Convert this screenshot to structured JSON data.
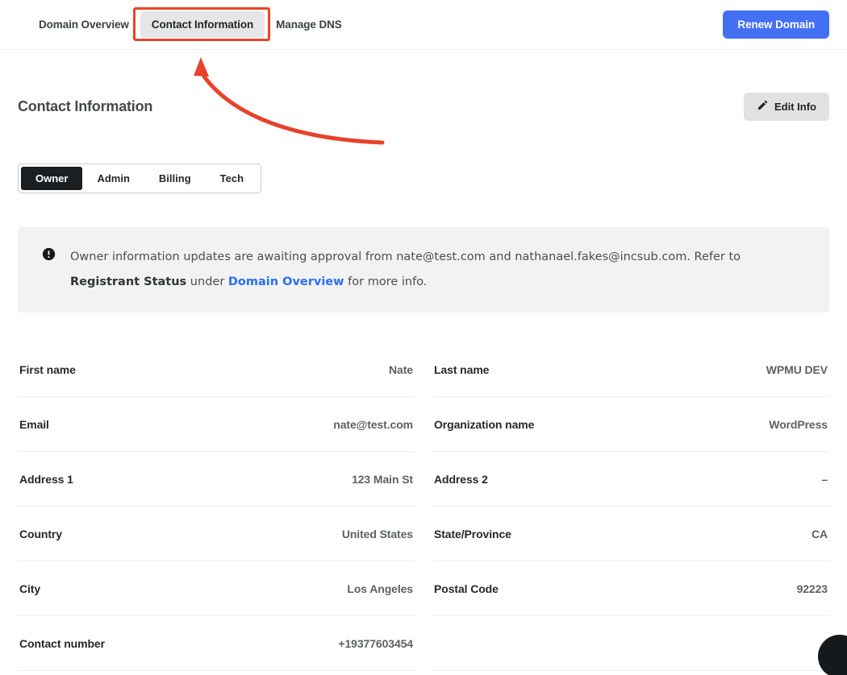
{
  "topnav": {
    "tabs": [
      {
        "label": "Domain Overview",
        "active": false
      },
      {
        "label": "Contact Information",
        "active": true
      },
      {
        "label": "Manage DNS",
        "active": false
      }
    ],
    "renew_label": "Renew Domain"
  },
  "page": {
    "title": "Contact Information",
    "edit_label": "Edit Info",
    "edit_icon": "pencil-icon"
  },
  "contact_tabs": [
    {
      "label": "Owner",
      "active": true
    },
    {
      "label": "Admin",
      "active": false
    },
    {
      "label": "Billing",
      "active": false
    },
    {
      "label": "Tech",
      "active": false
    }
  ],
  "notice": {
    "icon": "exclamation-circle-icon",
    "part1": "Owner information updates are awaiting approval from nate@test.com and nathanael.fakes@incsub.com. Refer to ",
    "bold1": "Registrant Status",
    "part2": " under ",
    "link": "Domain Overview",
    "part3": " for more info."
  },
  "details": [
    {
      "label": "First name",
      "value": "Nate"
    },
    {
      "label": "Last name",
      "value": "WPMU DEV"
    },
    {
      "label": "Email",
      "value": "nate@test.com"
    },
    {
      "label": "Organization name",
      "value": "WordPress"
    },
    {
      "label": "Address 1",
      "value": "123 Main St"
    },
    {
      "label": "Address 2",
      "value": "–"
    },
    {
      "label": "Country",
      "value": "United States"
    },
    {
      "label": "State/Province",
      "value": "CA"
    },
    {
      "label": "City",
      "value": "Los Angeles"
    },
    {
      "label": "Postal Code",
      "value": "92223"
    },
    {
      "label": "Contact number",
      "value": "+19377603454"
    },
    {
      "label": "",
      "value": ""
    }
  ],
  "annotations": {
    "highlight_color": "#ee4323",
    "arrow_color": "#e8412a"
  },
  "chat": {
    "icon": "chat-bubble-icon"
  }
}
